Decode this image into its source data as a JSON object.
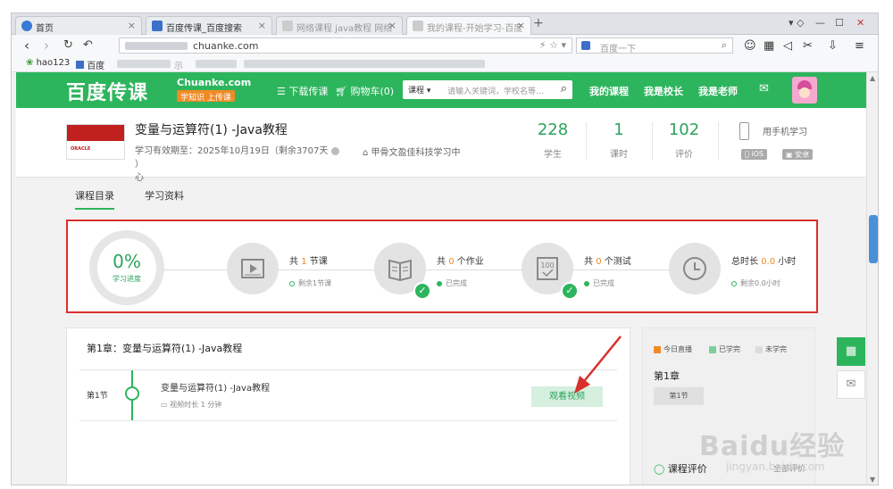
{
  "browser": {
    "tabs": [
      {
        "label": "首页"
      },
      {
        "label": "百度传课_百度搜索"
      },
      {
        "label": "网络课程 java教程 网络"
      },
      {
        "label": "我的课程-开始学习-百度"
      }
    ],
    "url": "chuanke.com",
    "search_placeholder": "百度一下",
    "bookmarks": [
      {
        "label": "hao123"
      },
      {
        "label": "百度"
      },
      {
        "label": "示"
      }
    ]
  },
  "site": {
    "logo": "百度传课",
    "logo_en": "Chuanke.com",
    "logo_slogan": "学知识 上传课",
    "nav_download": "下载传课",
    "nav_cart": "购物车(0)",
    "search_category": "课程",
    "search_placeholder": "请输入关键词，学校名等…",
    "links": [
      "我的课程",
      "我是校长",
      "我是老师"
    ]
  },
  "course": {
    "title": "变量与运算符(1) -Java教程",
    "validity": "学习有效期至：2025年10月19日（剩余3707天",
    "validity_tail": "）",
    "validity_wrap": "心",
    "org": "甲骨文盈佳科技学习中",
    "thumb_text": "ORACLE",
    "stats": [
      {
        "num": "228",
        "label": "学生"
      },
      {
        "num": "1",
        "label": "课时"
      },
      {
        "num": "102",
        "label": "评价"
      }
    ],
    "mobile_label": "用手机学习",
    "ios": "iOS",
    "android": "安卓"
  },
  "tabs": [
    "课程目录",
    "学习资料"
  ],
  "progress": {
    "percent": "0%",
    "percent_label": "学习进度",
    "items": [
      {
        "pre": "共",
        "num": "1",
        "post": "节课",
        "sub": "剩余1节课"
      },
      {
        "pre": "共",
        "num": "0",
        "post": "个作业",
        "sub": "已完成"
      },
      {
        "pre": "共",
        "num": "0",
        "post": "个测试",
        "sub": "已完成"
      },
      {
        "pre": "总时长",
        "num": "0.0",
        "post": "小时",
        "sub": "剩余0.0小时"
      }
    ]
  },
  "chapter": {
    "title": "第1章：变量与运算符(1) -Java教程",
    "section": "第1节",
    "lesson": "变量与运算符(1) -Java教程",
    "lesson_meta": "视频时长 1 分钟",
    "watch": "观看视频"
  },
  "sidebar": {
    "legend": [
      "今日直播",
      "已学完",
      "未学完"
    ],
    "legend_colors": [
      "#f08a24",
      "#7ccf9b",
      "#dcdcdc"
    ],
    "chapter": "第1章",
    "section": "第1节",
    "eval": "课程评价",
    "all": "全部评价"
  },
  "watermark": "Baidu经验",
  "watermark_sub": "jingyan.baidu.com"
}
